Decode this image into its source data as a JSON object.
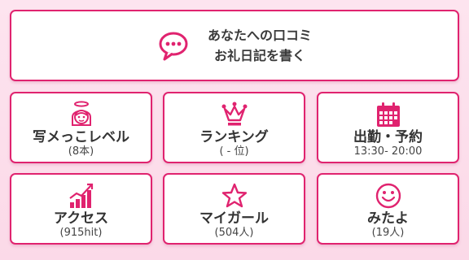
{
  "colors": {
    "accent": "#e0236f",
    "background": "#fde4ef",
    "text": "#333333"
  },
  "review_button": {
    "icon": "chat-bubble-icon",
    "line1": "あなたへの口コミ",
    "line2": "お礼日記を書く"
  },
  "tiles": [
    {
      "icon": "angel-face-icon",
      "label": "写メっこレベル",
      "sub": "(8本)"
    },
    {
      "icon": "crown-icon",
      "label": "ランキング",
      "sub": "( - 位)"
    },
    {
      "icon": "calendar-icon",
      "label": "出勤・予約",
      "sub": "13:30- 20:00"
    },
    {
      "icon": "bar-chart-icon",
      "label": "アクセス",
      "sub": "(915hit)"
    },
    {
      "icon": "star-icon",
      "label": "マイガール",
      "sub": "(504人)"
    },
    {
      "icon": "smiley-icon",
      "label": "みたよ",
      "sub": "(19人)"
    }
  ]
}
